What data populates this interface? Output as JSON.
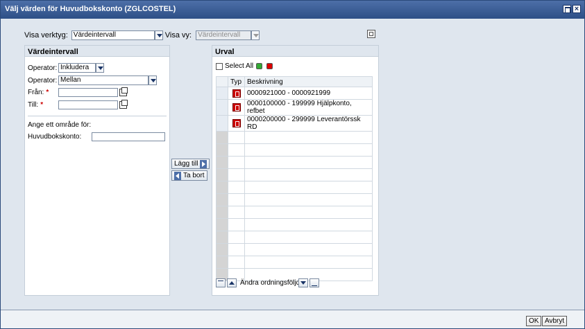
{
  "window": {
    "title": "Välj värden för Huvudbokskonto (ZGLCOSTEL)"
  },
  "toolbar": {
    "visa_verktyg_label": "Visa verktyg:",
    "visa_verktyg_value": "Värdeintervall",
    "visa_vy_label": "Visa vy:",
    "visa_vy_value": "Värdeintervall"
  },
  "left_panel": {
    "title": "Värdeintervall",
    "operator1_label": "Operator:",
    "operator1_value": "Inkludera",
    "operator2_label": "Operator:",
    "operator2_value": "Mellan",
    "fran_label": "Från:",
    "till_label": "Till:",
    "range_hint": "Ange ett område för:",
    "account_label": "Huvudbokskonto:"
  },
  "middle": {
    "add_label": "Lägg till",
    "remove_label": "Ta bort"
  },
  "right_panel": {
    "title": "Urval",
    "select_all_label": "Select All",
    "col_typ": "Typ",
    "col_beskrivning": "Beskrivning",
    "rows": [
      {
        "desc": "0000921000 - 0000921999"
      },
      {
        "desc": "0000100000 - 199999 Hjälpkonto, refbet"
      },
      {
        "desc": "0000200000 - 299999 Leverantörssk RD"
      }
    ],
    "reorder_label": "Ändra ordningsföljd"
  },
  "footer": {
    "ok_label": "OK",
    "cancel_label": "Avbryt"
  },
  "colors": {
    "titlebar": "#2d4f86",
    "accent_green": "#33aa33",
    "accent_red": "#dd0000"
  }
}
